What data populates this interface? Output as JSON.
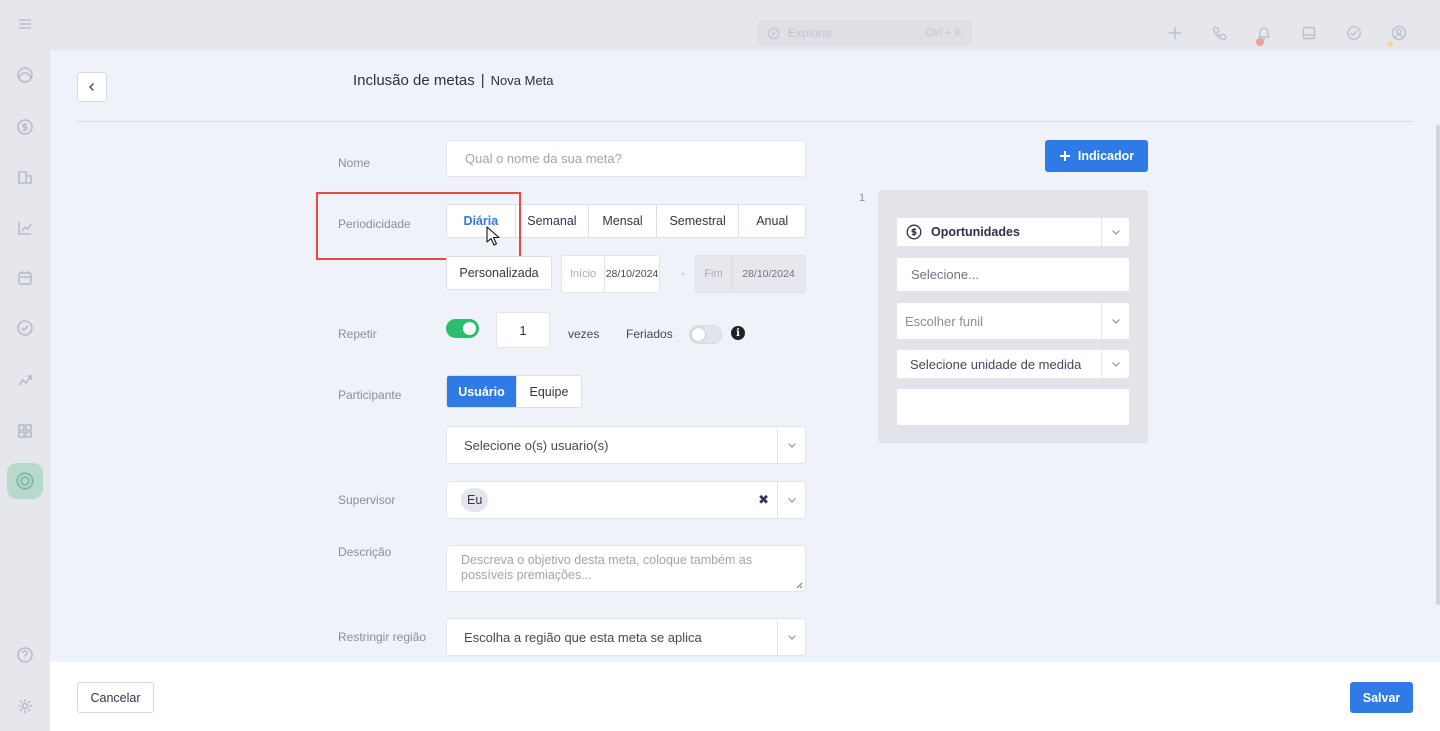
{
  "background": {
    "search": {
      "label": "Explorar",
      "shortcut": "Ctrl + K"
    },
    "sidebar_icons": [
      "menu-icon",
      "dashboard-icon",
      "dollar-icon",
      "building-icon",
      "chart-icon",
      "calendar-icon",
      "check-circle-icon",
      "trend-icon",
      "apps-icon",
      "goal-icon",
      "help-icon",
      "settings-icon"
    ],
    "top_icons": [
      "plus-icon",
      "phone-icon",
      "bell-icon",
      "inbox-icon",
      "check-icon",
      "user-icon"
    ]
  },
  "header": {
    "title": "Inclusão de metas",
    "separator": "|",
    "subtitle": "Nova Meta"
  },
  "form": {
    "nome": {
      "label": "Nome",
      "placeholder": "Qual o nome da sua meta?"
    },
    "periodicidade": {
      "label": "Periodicidade",
      "options": [
        "Diária",
        "Semanal",
        "Mensal",
        "Semestral",
        "Anual"
      ],
      "selected": "Diária",
      "custom_label": "Personalizada",
      "inicio_label": "Início",
      "inicio_value": "28/10/2024",
      "range_sep": "-",
      "fim_label": "Fim",
      "fim_value": "28/10/2024"
    },
    "repetir": {
      "label": "Repetir",
      "enabled": true,
      "count": "1",
      "unit": "vezes",
      "feriados_label": "Feriados",
      "feriados_enabled": false
    },
    "participante": {
      "label": "Participante",
      "options": [
        "Usuário",
        "Equipe"
      ],
      "selected": "Usuário",
      "select_placeholder": "Selecione o(s) usuario(s)"
    },
    "supervisor": {
      "label": "Supervisor",
      "value": "Eu"
    },
    "descricao": {
      "label": "Descrição",
      "placeholder": "Descreva o objetivo desta meta, coloque também as possíveis premiações..."
    },
    "regiao": {
      "label": "Restringir região",
      "placeholder": "Escolha a região que esta meta se aplica"
    }
  },
  "indicators": {
    "add_button": "Indicador",
    "index": "1",
    "type": "Oportunidades",
    "select_placeholder": "Selecione...",
    "funnel_placeholder": "Escolher funil",
    "unit_placeholder": "Selecione unidade de medida",
    "value": ""
  },
  "footer": {
    "cancel": "Cancelar",
    "save": "Salvar"
  },
  "colors": {
    "primary": "#2e7be5",
    "toggle_on": "#2dbd6e",
    "highlight": "#e64a4a"
  }
}
